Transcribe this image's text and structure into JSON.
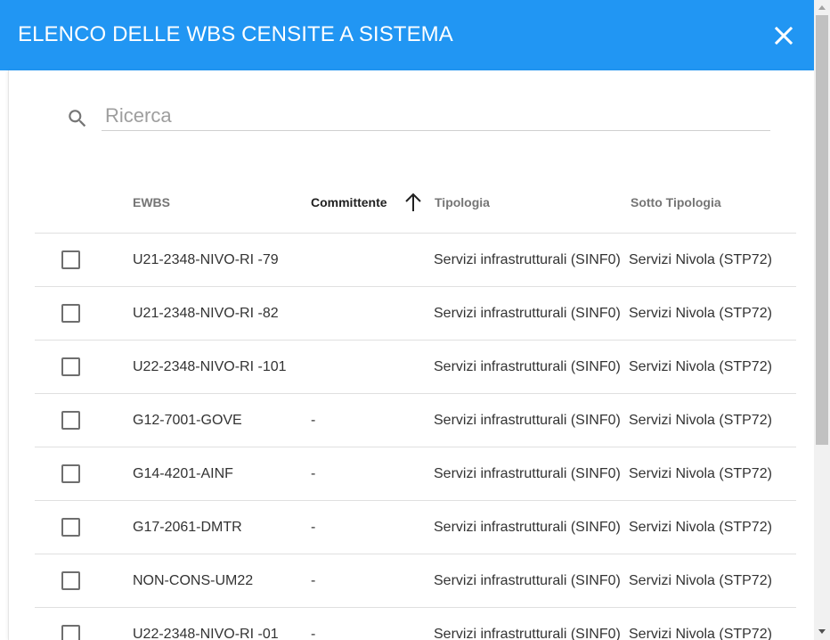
{
  "dialog": {
    "title": "ELENCO DELLE WBS CENSITE A SISTEMA",
    "close_icon": "close-icon"
  },
  "search": {
    "placeholder": "Ricerca",
    "value": "",
    "icon": "search-icon"
  },
  "table": {
    "columns": {
      "ewbs": "EWBS",
      "committente": "Committente",
      "tipologia": "Tipologia",
      "sotto_tipologia": "Sotto Tipologia"
    },
    "sort": {
      "column": "Committente",
      "direction": "ascending",
      "icon": "arrow-up-icon"
    },
    "rows": [
      {
        "ewbs": "U21-2348-NIVO-RI -79",
        "committente": "",
        "tipologia": "Servizi infrastrutturali (SINF0)",
        "sotto_tipologia": "Servizi Nivola (STP72)"
      },
      {
        "ewbs": "U21-2348-NIVO-RI -82",
        "committente": "",
        "tipologia": "Servizi infrastrutturali (SINF0)",
        "sotto_tipologia": "Servizi Nivola (STP72)"
      },
      {
        "ewbs": "U22-2348-NIVO-RI -101",
        "committente": "",
        "tipologia": "Servizi infrastrutturali (SINF0)",
        "sotto_tipologia": "Servizi Nivola (STP72)"
      },
      {
        "ewbs": "G12-7001-GOVE",
        "committente": "-",
        "tipologia": "Servizi infrastrutturali (SINF0)",
        "sotto_tipologia": "Servizi Nivola (STP72)"
      },
      {
        "ewbs": "G14-4201-AINF",
        "committente": "-",
        "tipologia": "Servizi infrastrutturali (SINF0)",
        "sotto_tipologia": "Servizi Nivola (STP72)"
      },
      {
        "ewbs": "G17-2061-DMTR",
        "committente": "-",
        "tipologia": "Servizi infrastrutturali (SINF0)",
        "sotto_tipologia": "Servizi Nivola (STP72)"
      },
      {
        "ewbs": "NON-CONS-UM22",
        "committente": "-",
        "tipologia": "Servizi infrastrutturali (SINF0)",
        "sotto_tipologia": "Servizi Nivola (STP72)"
      },
      {
        "ewbs": "U22-2348-NIVO-RI -01",
        "committente": "-",
        "tipologia": "Servizi infrastrutturali (SINF0)",
        "sotto_tipologia": "Servizi Nivola (STP72)"
      }
    ]
  },
  "colors": {
    "header_bg": "#2196f3",
    "header_text": "#ffffff",
    "row_divider": "#e0e0e0"
  }
}
